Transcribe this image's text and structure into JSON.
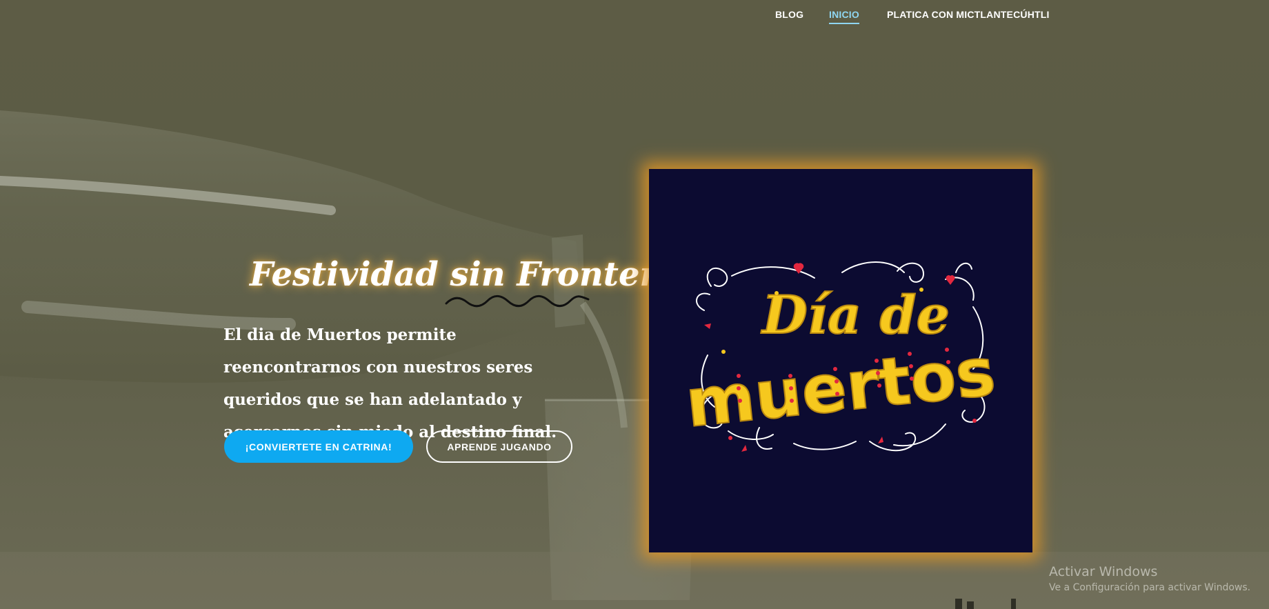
{
  "nav": {
    "items": [
      {
        "label": "BLOG",
        "active": false
      },
      {
        "label": "INICIO",
        "active": true
      },
      {
        "label": "PLATICA CON MICTLANTECÚHTLI",
        "active": false
      }
    ]
  },
  "hero": {
    "title": "Festividad sin Fronteras",
    "description": "El dia de Muertos permite reencontrarnos con nuestros seres queridos que se han adelantado y acercarnos sin miedo al destino final.",
    "primary_button": "¡CONVIERTETE EN CATRINA!",
    "secondary_button": "APRENDE JUGANDO"
  },
  "poster": {
    "line1": "Día de",
    "line2": "muertos",
    "colors": {
      "background": "#0c0b31",
      "letters": "#f6c81e",
      "dots": "#e3283f",
      "glow": "#e29626"
    }
  },
  "watermark": {
    "title": "Activar Windows",
    "subtitle": "Ve a Configuración para activar Windows."
  },
  "colors": {
    "accent": "#0ea9f1",
    "active_nav": "#8fd6f2",
    "background": "#5d5c45"
  }
}
